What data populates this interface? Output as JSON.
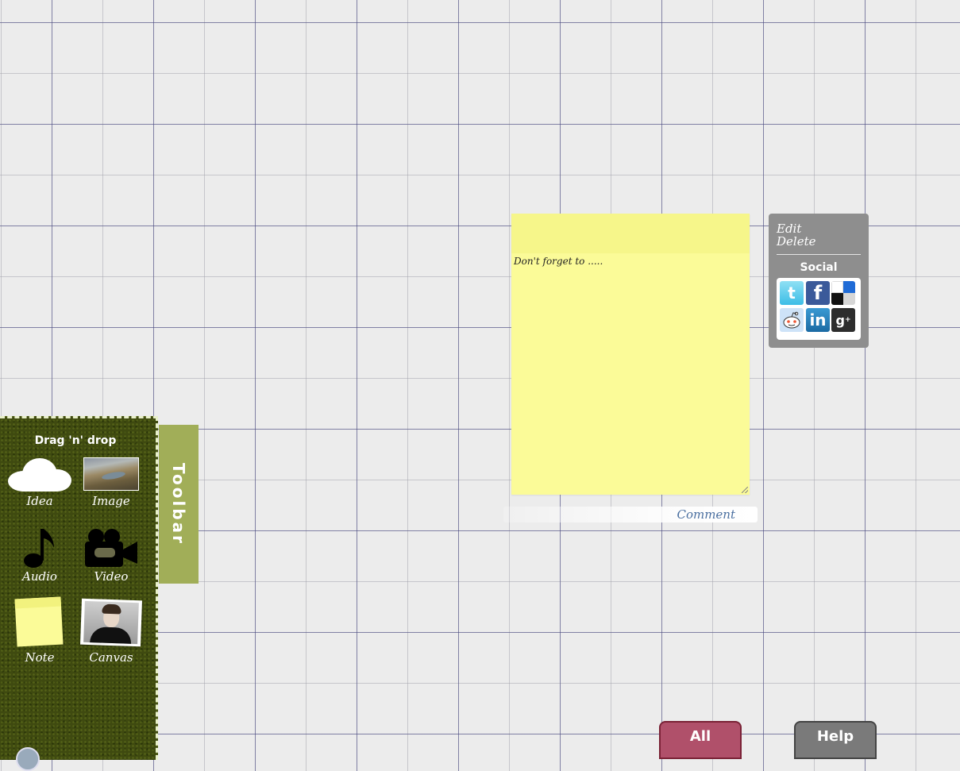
{
  "note": {
    "text": "Don't forget to ....."
  },
  "comment": {
    "label": "Comment"
  },
  "context_menu": {
    "edit": "Edit",
    "delete": "Delete",
    "social_title": "Social",
    "social_icons": [
      "twitter-icon",
      "facebook-icon",
      "delicious-icon",
      "reddit-icon",
      "linkedin-icon",
      "google-plus-icon"
    ]
  },
  "toolbar": {
    "tab_label": "Toolbar",
    "title": "Drag 'n' drop",
    "items": [
      {
        "label": "Idea",
        "icon": "cloud-icon"
      },
      {
        "label": "Image",
        "icon": "image-icon"
      },
      {
        "label": "Audio",
        "icon": "music-note-icon"
      },
      {
        "label": "Video",
        "icon": "video-camera-icon"
      },
      {
        "label": "Note",
        "icon": "sticky-note-icon"
      },
      {
        "label": "Canvas",
        "icon": "canvas-icon"
      }
    ]
  },
  "buttons": {
    "all": "All",
    "help": "Help"
  },
  "colors": {
    "note": "#fbfb98",
    "toolbar_bg": "#3f4a10",
    "toolbar_tab": "#a1ae58",
    "all_button": "#b0506a",
    "help_button": "#7a7a7a",
    "context_panel": "#8e8e8e"
  }
}
